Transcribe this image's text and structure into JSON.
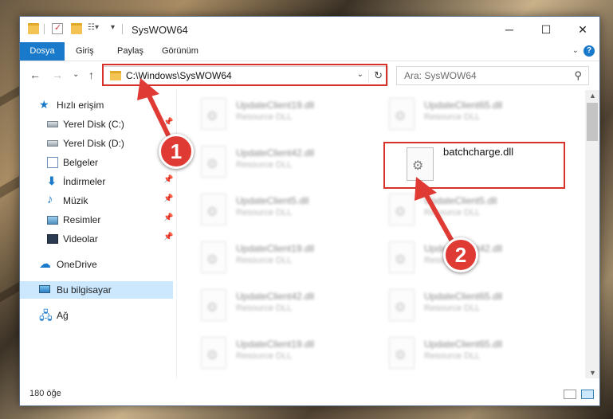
{
  "window": {
    "title": "SysWOW64",
    "controls": {
      "minimize": "─",
      "maximize": "☐",
      "close": "✕"
    }
  },
  "ribbon": {
    "tabs": [
      {
        "label": "Dosya",
        "active": true
      },
      {
        "label": "Giriş"
      },
      {
        "label": "Paylaş"
      },
      {
        "label": "Görünüm"
      }
    ],
    "help": "?"
  },
  "navigation": {
    "address": "C:\\Windows\\SysWOW64",
    "search_placeholder": "Ara: SysWOW64"
  },
  "sidebar": {
    "items": [
      {
        "label": "Hızlı erişim",
        "icon": "star-icon"
      },
      {
        "label": "Yerel Disk (C:)",
        "icon": "drive-icon",
        "pinned": true
      },
      {
        "label": "Yerel Disk (D:)",
        "icon": "drive-icon",
        "pinned": true
      },
      {
        "label": "Belgeler",
        "icon": "documents-icon",
        "pinned": true
      },
      {
        "label": "İndirmeler",
        "icon": "downloads-icon",
        "pinned": true
      },
      {
        "label": "Müzik",
        "icon": "music-icon",
        "pinned": true
      },
      {
        "label": "Resimler",
        "icon": "pictures-icon",
        "pinned": true
      },
      {
        "label": "Videolar",
        "icon": "videos-icon",
        "pinned": true
      },
      {
        "label": "OneDrive",
        "icon": "onedrive-icon"
      },
      {
        "label": "Bu bilgisayar",
        "icon": "computer-icon",
        "selected": true
      },
      {
        "label": "Ağ",
        "icon": "network-icon"
      }
    ]
  },
  "files": {
    "left_column": [
      {
        "name": "UpdateClient19.dll",
        "type": "Resource DLL"
      },
      {
        "name": "UpdateClient42.dll",
        "type": "Resource DLL"
      },
      {
        "name": "UpdateClient5.dll",
        "type": "Resource DLL"
      },
      {
        "name": "UpdateClient19.dll",
        "type": "Resource DLL"
      },
      {
        "name": "UpdateClient42.dll",
        "type": "Resource DLL"
      },
      {
        "name": "UpdateClient19.dll",
        "type": "Resource DLL"
      }
    ],
    "right_column": [
      {
        "name": "UpdateClient65.dll",
        "type": "Resource DLL"
      },
      {
        "name": "batchcharge.dll",
        "type": ""
      },
      {
        "name": "UpdateClient5.dll",
        "type": "Resource DLL"
      },
      {
        "name": "UpdateClient42.dll",
        "type": "Resource DLL"
      },
      {
        "name": "UpdateClient65.dll",
        "type": "Resource DLL"
      },
      {
        "name": "UpdateClient65.dll",
        "type": "Resource DLL"
      }
    ]
  },
  "status": {
    "count": "180 öğe"
  },
  "annotations": {
    "step1": "1",
    "step2": "2",
    "color": "#d8312a"
  }
}
